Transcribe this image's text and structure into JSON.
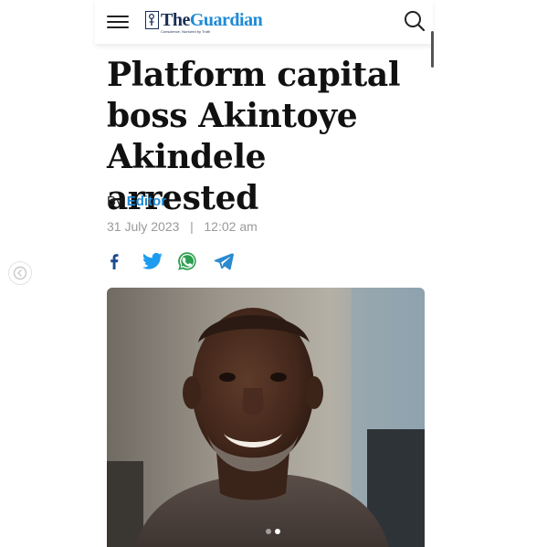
{
  "header": {
    "logo": {
      "the": "The",
      "guardian": "Guardian",
      "tagline": "Conscience, Nurtured by Truth"
    },
    "menu_icon": "hamburger-icon",
    "search_icon": "search-icon"
  },
  "article": {
    "headline": "Platform capital boss Akintoye Akindele arrested",
    "byline_prefix": "By",
    "author": "Editor",
    "date": "31 July 2023",
    "separator": "|",
    "time": "12:02 am"
  },
  "share": [
    {
      "name": "facebook",
      "icon": "facebook-icon",
      "color": "#1f4a8f"
    },
    {
      "name": "twitter",
      "icon": "twitter-icon",
      "color": "#1d9bf0"
    },
    {
      "name": "whatsapp",
      "icon": "whatsapp-icon",
      "color": "#2c9e4f"
    },
    {
      "name": "telegram",
      "icon": "telegram-icon",
      "color": "#2b8ad0"
    }
  ],
  "carousel": {
    "prev_icon": "chevron-left-icon",
    "slide_count": 2,
    "active_slide": 2
  },
  "colors": {
    "brand_navy": "#1a2d55",
    "brand_blue": "#1e8ad6",
    "headline": "#111111",
    "meta_gray": "#9a9a9a"
  }
}
